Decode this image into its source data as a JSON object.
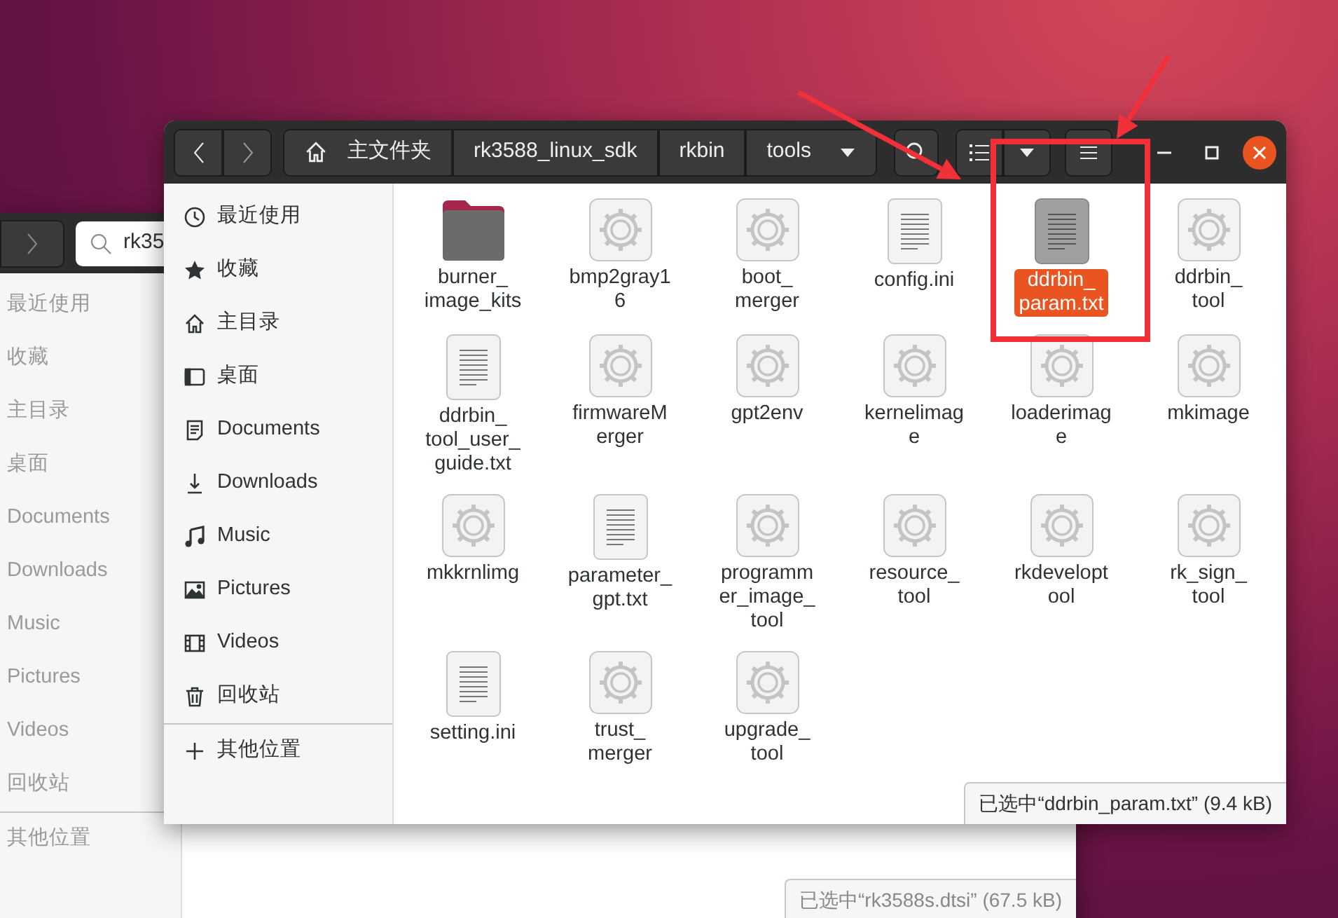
{
  "back_window": {
    "search": {
      "value": "rk35"
    },
    "sidebar": {
      "items": [
        {
          "label": "最近使用"
        },
        {
          "label": "收藏"
        },
        {
          "label": "主目录"
        },
        {
          "label": "桌面"
        },
        {
          "label": "Documents"
        },
        {
          "label": "Downloads"
        },
        {
          "label": "Music"
        },
        {
          "label": "Pictures"
        },
        {
          "label": "Videos"
        },
        {
          "label": "回收站"
        }
      ],
      "other": {
        "label": "其他位置"
      }
    },
    "status": "已选中“rk3588s.dtsi” (67.5 kB)"
  },
  "window": {
    "breadcrumbs": [
      {
        "label": "主文件夹",
        "kind": "home"
      },
      {
        "label": "rk3588_linux_sdk",
        "kind": "folder"
      },
      {
        "label": "rkbin",
        "kind": "folder"
      },
      {
        "label": "tools",
        "kind": "current"
      }
    ],
    "sidebar": {
      "items": [
        {
          "label": "最近使用",
          "kind": "recent"
        },
        {
          "label": "收藏",
          "kind": "starred"
        },
        {
          "label": "主目录",
          "kind": "home"
        },
        {
          "label": "桌面",
          "kind": "desktop"
        },
        {
          "label": "Documents",
          "kind": "documents"
        },
        {
          "label": "Downloads",
          "kind": "downloads"
        },
        {
          "label": "Music",
          "kind": "music"
        },
        {
          "label": "Pictures",
          "kind": "pictures"
        },
        {
          "label": "Videos",
          "kind": "videos"
        },
        {
          "label": "回收站",
          "kind": "trash"
        }
      ],
      "other": {
        "label": "其他位置",
        "kind": "add"
      }
    },
    "files": [
      {
        "lines": [
          "burner_",
          "image_kits"
        ],
        "kind": "folder",
        "selected": false
      },
      {
        "lines": [
          "bmp2gray1",
          "6"
        ],
        "kind": "executable",
        "selected": false
      },
      {
        "lines": [
          "boot_",
          "merger"
        ],
        "kind": "executable",
        "selected": false
      },
      {
        "lines": [
          "config.ini"
        ],
        "kind": "text",
        "selected": false
      },
      {
        "lines": [
          "ddrbin_",
          "param.txt"
        ],
        "kind": "text",
        "selected": true
      },
      {
        "lines": [
          "ddrbin_",
          "tool"
        ],
        "kind": "executable",
        "selected": false
      },
      {
        "lines": [
          "ddrbin_",
          "tool_user_",
          "guide.txt"
        ],
        "kind": "text",
        "selected": false
      },
      {
        "lines": [
          "firmwareM",
          "erger"
        ],
        "kind": "executable",
        "selected": false
      },
      {
        "lines": [
          "gpt2env"
        ],
        "kind": "executable",
        "selected": false
      },
      {
        "lines": [
          "kernelimag",
          "e"
        ],
        "kind": "executable",
        "selected": false
      },
      {
        "lines": [
          "loaderimag",
          "e"
        ],
        "kind": "executable",
        "selected": false
      },
      {
        "lines": [
          "mkimage"
        ],
        "kind": "executable",
        "selected": false
      },
      {
        "lines": [
          "mkkrnlimg"
        ],
        "kind": "executable",
        "selected": false
      },
      {
        "lines": [
          "parameter_",
          "gpt.txt"
        ],
        "kind": "text",
        "selected": false
      },
      {
        "lines": [
          "programm",
          "er_image_",
          "tool"
        ],
        "kind": "executable",
        "selected": false
      },
      {
        "lines": [
          "resource_",
          "tool"
        ],
        "kind": "executable",
        "selected": false
      },
      {
        "lines": [
          "rkdevelopt",
          "ool"
        ],
        "kind": "executable",
        "selected": false
      },
      {
        "lines": [
          "rk_sign_",
          "tool"
        ],
        "kind": "executable",
        "selected": false
      },
      {
        "lines": [
          "setting.ini"
        ],
        "kind": "text",
        "selected": false
      },
      {
        "lines": [
          "trust_",
          "merger"
        ],
        "kind": "executable",
        "selected": false
      },
      {
        "lines": [
          "upgrade_",
          "tool"
        ],
        "kind": "executable",
        "selected": false
      }
    ],
    "status": "已选中“ddrbin_param.txt” (9.4 kB)"
  },
  "annotations": [
    {
      "kind": "box"
    },
    {
      "kind": "arrow"
    },
    {
      "kind": "arrow"
    }
  ]
}
